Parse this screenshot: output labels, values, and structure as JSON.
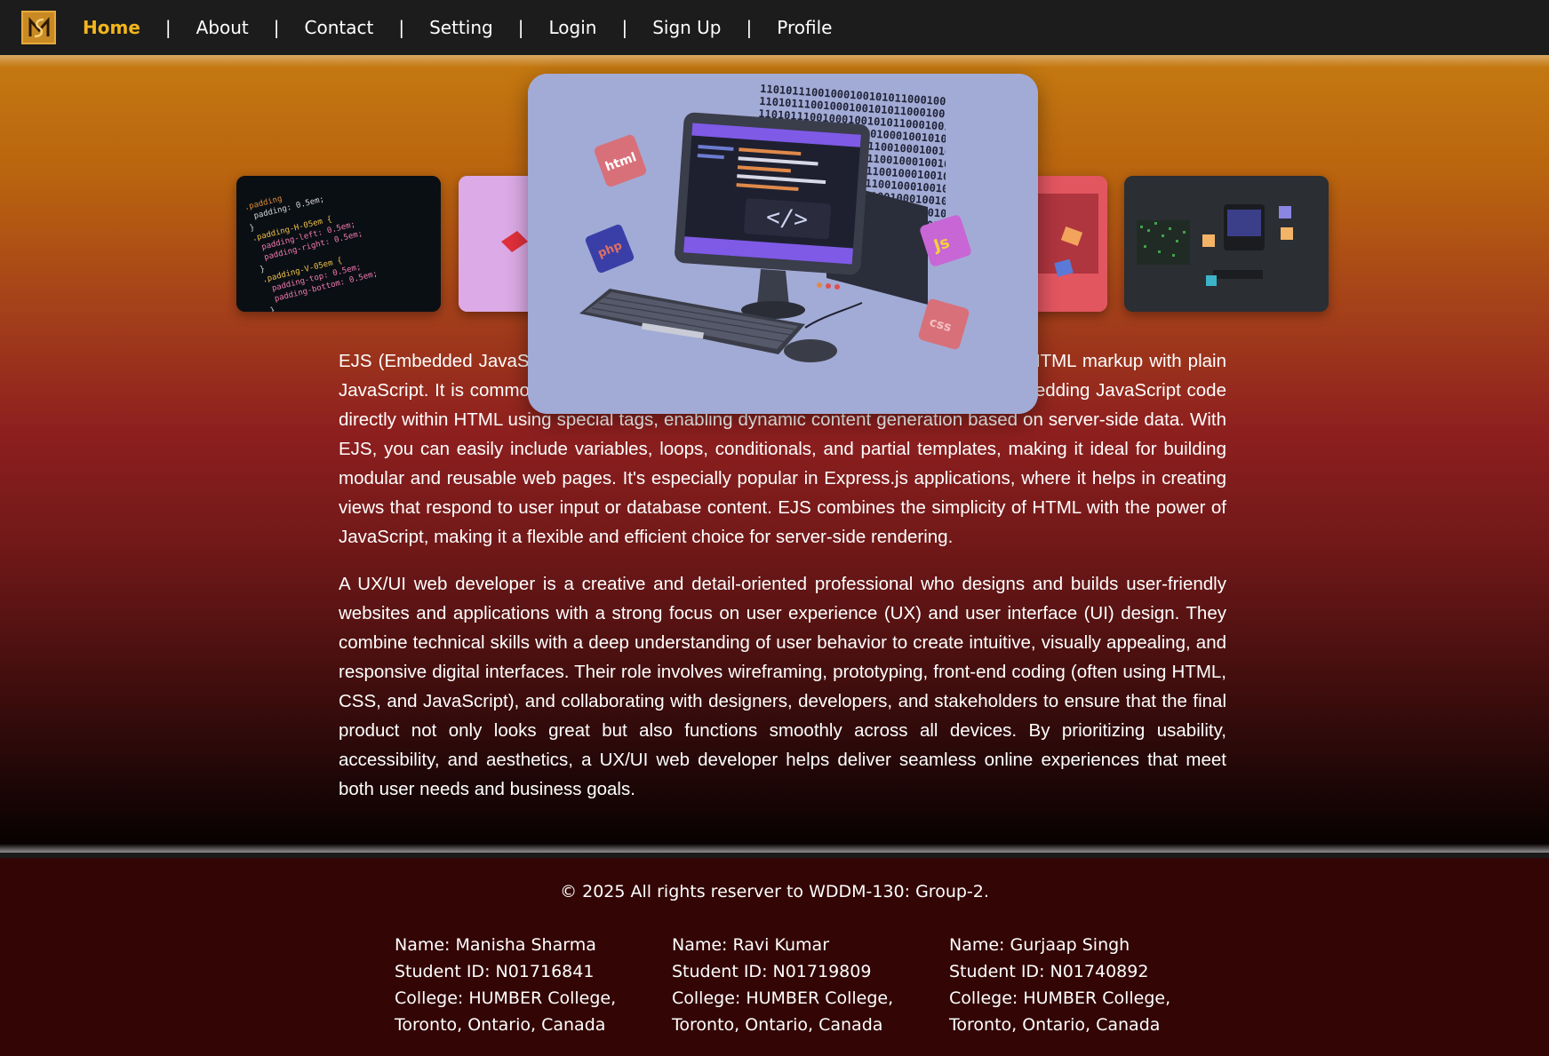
{
  "nav": {
    "logo_icon": "ms-monogram-logo-icon",
    "items": [
      {
        "label": "Home",
        "active": true
      },
      {
        "label": "About"
      },
      {
        "label": "Contact"
      },
      {
        "label": "Setting"
      },
      {
        "label": "Login"
      },
      {
        "label": "Sign Up"
      },
      {
        "label": "Profile"
      }
    ],
    "separator": "|",
    "active_color": "#f2b51c"
  },
  "carousel": {
    "slides": [
      "css-code-screenshot",
      "pink-3d-shape",
      "computer-with-code-illustration",
      "red-laptop-illustration",
      "dark-workspace-illustration"
    ],
    "center_badges": [
      "html",
      "php",
      "Js",
      "css"
    ],
    "binary_text": "110101110010001001010110001001000101101000101101",
    "css_code": [
      ".padding",
      "padding: 0.5em;",
      "}",
      ".padding-H-05em {",
      "padding-left: 0.5em;",
      "padding-right: 0.5em;",
      "}",
      ".padding-V-05em {",
      "padding-top: 0.5em;",
      "padding-bottom: 0.5em;",
      "}"
    ]
  },
  "content": {
    "paragraph1": "EJS (Embedded JavaScript) is a simple templating language that lets you generate HTML markup with plain JavaScript. It is commonly used with Node.js to render dynamic HTML pages by embedding JavaScript code directly within HTML using special tags, enabling dynamic content generation based on server-side data. With EJS, you can easily include variables, loops, conditionals, and partial templates, making it ideal for building modular and reusable web pages. It's especially popular in Express.js applications, where it helps in creating views that respond to user input or database content. EJS combines the simplicity of HTML with the power of JavaScript, making it a flexible and efficient choice for server-side rendering.",
    "paragraph2": "A UX/UI web developer is a creative and detail-oriented professional who designs and builds user-friendly websites and applications with a strong focus on user experience (UX) and user interface (UI) design. They combine technical skills with a deep understanding of user behavior to create intuitive, visually appealing, and responsive digital interfaces. Their role involves wireframing, prototyping, front-end coding (often using HTML, CSS, and JavaScript), and collaborating with designers, developers, and stakeholders to ensure that the final product not only looks great but also functions smoothly across all devices. By prioritizing usability, accessibility, and aesthetics, a UX/UI web developer helps deliver seamless online experiences that meet both user needs and business goals."
  },
  "footer": {
    "copyright": "© 2025 All rights reserver to WDDM-130: Group-2.",
    "members": [
      {
        "name": "Name: Manisha Sharma",
        "id": "Student ID: N01716841",
        "college": "College: HUMBER College,",
        "location": "Toronto, Ontario, Canada"
      },
      {
        "name": "Name: Ravi Kumar",
        "id": "Student ID: N01719809",
        "college": "College: HUMBER College,",
        "location": "Toronto, Ontario, Canada"
      },
      {
        "name": "Name: Gurjaap Singh",
        "id": "Student ID: N01740892",
        "college": "College: HUMBER College,",
        "location": "Toronto, Ontario, Canada"
      }
    ]
  }
}
